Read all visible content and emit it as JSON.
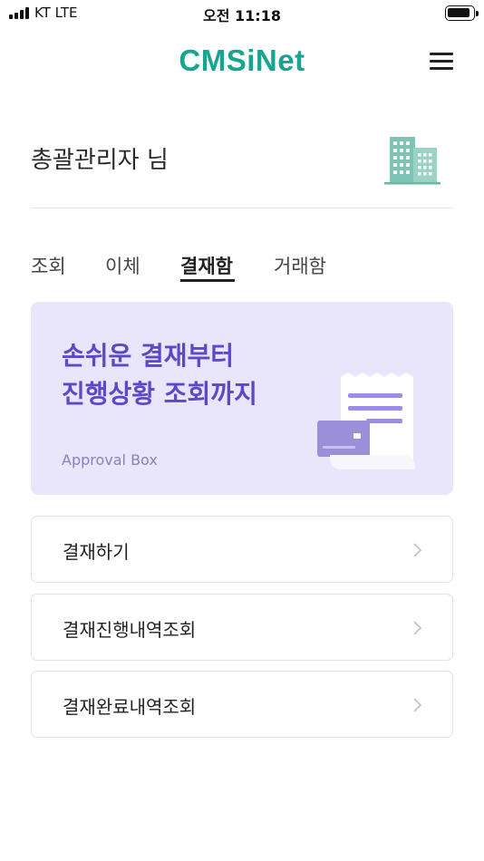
{
  "status_bar": {
    "carrier": "KT  LTE",
    "time": "오전 11:18"
  },
  "header": {
    "logo": "CMSiNet",
    "menu_icon": "hamburger-menu-icon"
  },
  "greeting": {
    "text": "총괄관리자 님",
    "icon": "building-icon"
  },
  "tabs": [
    {
      "label": "조회",
      "active": false
    },
    {
      "label": "이체",
      "active": false
    },
    {
      "label": "결재함",
      "active": true
    },
    {
      "label": "거래함",
      "active": false
    }
  ],
  "banner": {
    "line1": "손쉬운 결재부터",
    "line2": "진행상황 조회까지",
    "subtitle": "Approval Box",
    "illustration": "receipt-and-card-icon"
  },
  "menu_items": [
    {
      "label": "결재하기"
    },
    {
      "label": "결재진행내역조회"
    },
    {
      "label": "결재완료내역조회"
    }
  ],
  "colors": {
    "brand": "#17a491",
    "banner_bg": "#e9e6fb",
    "banner_text": "#5e48c8",
    "building": "#7cc5b6"
  }
}
